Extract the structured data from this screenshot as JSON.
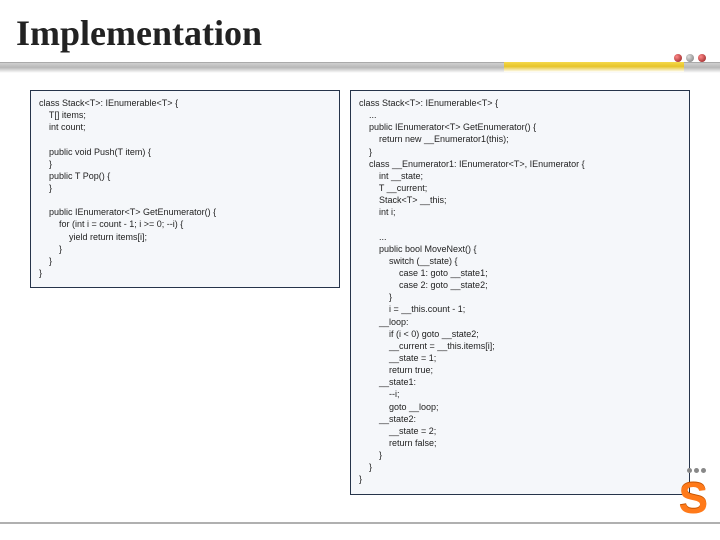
{
  "title": "Implementation",
  "code_left": "class Stack<T>: IEnumerable<T> {\n    T[] items;\n    int count;\n\n    public void Push(T item) {\n    }\n    public T Pop() {\n    }\n\n    public IEnumerator<T> GetEnumerator() {\n        for (int i = count - 1; i >= 0; --i) {\n            yield return items[i];\n        }\n    }\n}",
  "code_right": "class Stack<T>: IEnumerable<T> {\n    ...\n    public IEnumerator<T> GetEnumerator() {\n        return new __Enumerator1(this);\n    }\n    class __Enumerator1: IEnumerator<T>, IEnumerator {\n        int __state;\n        T __current;\n        Stack<T> __this;\n        int i;\n\n        ...\n        public bool MoveNext() {\n            switch (__state) {\n                case 1: goto __state1;\n                case 2: goto __state2;\n            }\n            i = __this.count - 1;\n        __loop:\n            if (i < 0) goto __state2;\n            __current = __this.items[i];\n            __state = 1;\n            return true;\n        __state1:\n            --i;\n            goto __loop;\n        __state2:\n            __state = 2;\n            return false;\n        }\n    }\n}"
}
